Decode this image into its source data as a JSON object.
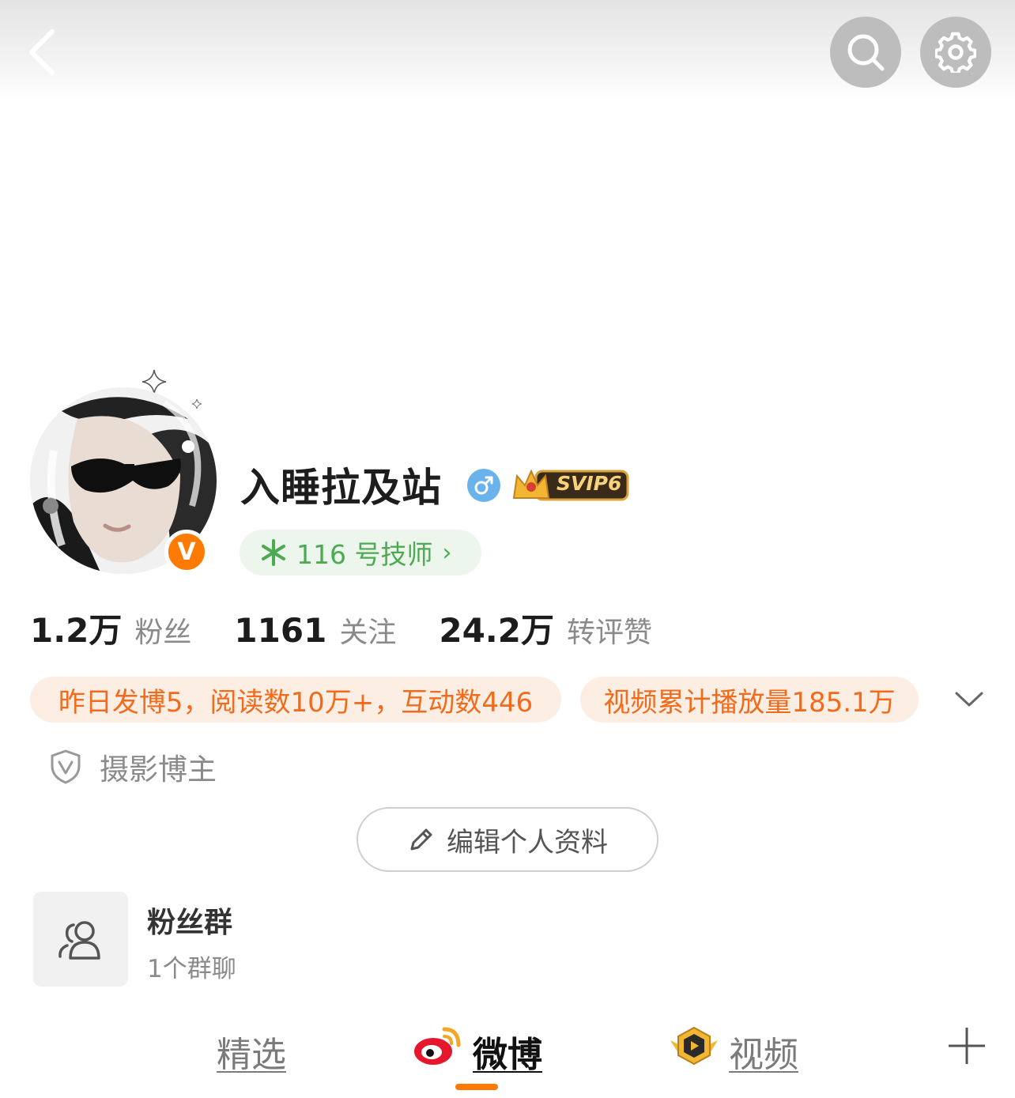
{
  "header": {
    "back_icon": "chevron-left-icon",
    "search_icon": "search-icon",
    "settings_icon": "gear-icon"
  },
  "profile": {
    "name": "入睡拉及站",
    "gender_icon": "male-icon",
    "svip_label": "SVIP6",
    "tech_label": "116 号技师",
    "verified_letter": "V"
  },
  "stats": [
    {
      "value": "1.2万",
      "label": "粉丝"
    },
    {
      "value": "1161",
      "label": "关注"
    },
    {
      "value": "24.2万",
      "label": "转评赞"
    }
  ],
  "highlights": {
    "yesterday": "昨日发博5，阅读数10万+，互动数446",
    "video_plays": "视频累计播放量185.1万"
  },
  "blogger_tag": "摄影博主",
  "edit_profile_label": "编辑个人资料",
  "fan_group": {
    "title": "粉丝群",
    "subtitle": "1个群聊"
  },
  "tabs": {
    "featured": "精选",
    "weibo": "微博",
    "video": "视频"
  },
  "colors": {
    "accent_orange": "#ff7a00",
    "pill_text": "#f26b1d",
    "tech_green": "#4caa52"
  }
}
